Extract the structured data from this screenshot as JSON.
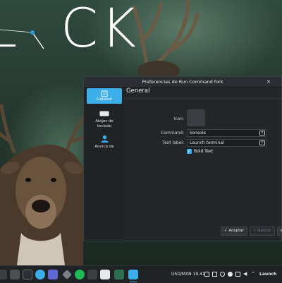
{
  "lockscreen": {
    "word": "CK",
    "prefix_letter": "L"
  },
  "window": {
    "title": "Preferencias de Run Command fork",
    "sidebar": {
      "items": [
        {
          "label": "General",
          "icon": "settings-icon",
          "active": true
        },
        {
          "label": "Atajos de teclado",
          "icon": "keyboard-icon",
          "active": false
        },
        {
          "label": "Acerca de",
          "icon": "user-icon",
          "active": false
        }
      ]
    },
    "section_title": "General",
    "form": {
      "icon_label": "Icon:",
      "command_label": "Command:",
      "command_value": "konsole",
      "text_label_label": "Text label:",
      "text_label_value": "Launch terminal",
      "bold_text_label": "Bold Text",
      "bold_text_checked": true
    },
    "buttons": {
      "ok_label": "Aceptar",
      "apply_label": "Aplicar"
    }
  },
  "taskbar": {
    "currency": "USD/MXN 19.41",
    "task_label": "Launch",
    "accent_color": "#3daee9"
  }
}
